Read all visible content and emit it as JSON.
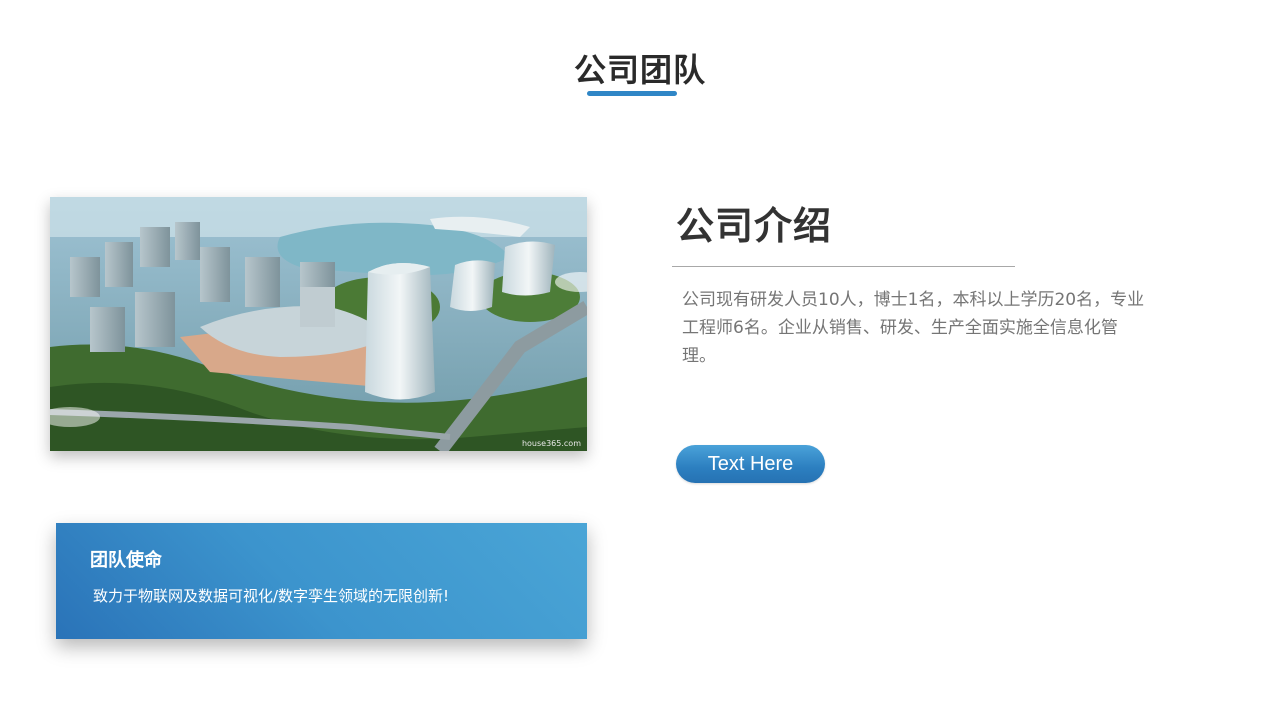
{
  "header": {
    "title": "公司团队",
    "accent_color": "#2f86c6"
  },
  "photo": {
    "description_icon": "aerial-city-photo",
    "watermark": "house365.com"
  },
  "mission": {
    "title": "团队使命",
    "text": "致力于物联网及数据可视化/数字孪生领域的无限创新!",
    "background_color": "#3c94cd"
  },
  "intro": {
    "heading": "公司介绍",
    "body": "公司现有研发人员10人，博士1名，本科以上学历20名，专业工程师6名。企业从销售、研发、生产全面实施全信息化管理。",
    "button_label": "Text Here",
    "button_color": "#2c7fc0"
  }
}
